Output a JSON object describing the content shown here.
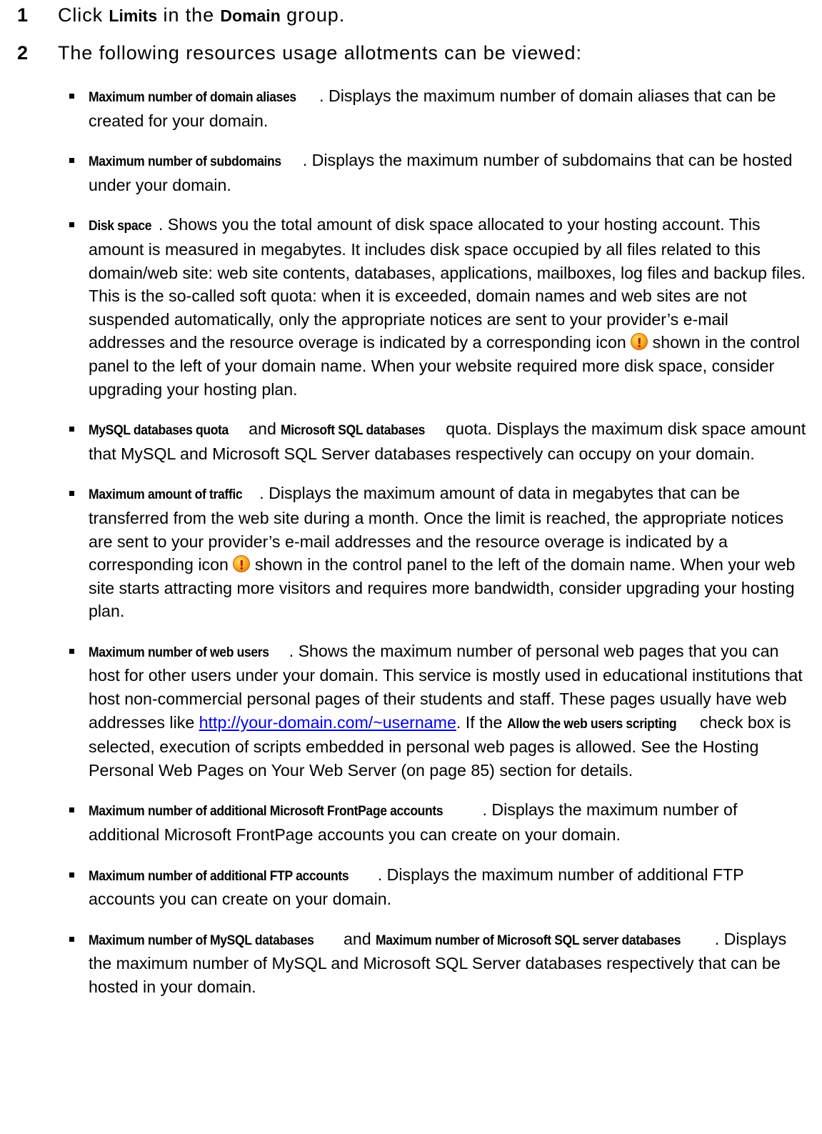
{
  "step1": {
    "number": "1",
    "pre": "Click ",
    "limits": "Limits",
    "mid": " in the ",
    "domain": "Domain",
    "post": " group."
  },
  "step2": {
    "number": "2",
    "text": "The following resources usage allotments can be viewed:"
  },
  "items": {
    "domain_aliases": {
      "term": "Maximum number of domain aliases",
      "desc": ". Displays the maximum number of domain aliases that can be created for your domain."
    },
    "subdomains": {
      "term": "Maximum number of subdomains",
      "desc": ". Displays the maximum number of subdomains that can be hosted under your domain."
    },
    "disk_space": {
      "term": "Disk space",
      "desc1": ". Shows you the total amount of disk space allocated to your hosting account. This amount is measured in megabytes. It includes disk space occupied by all files related to this domain/web site: web site contents, databases, applications, mailboxes, log files and backup files. This is the so-called soft quota: when it is exceeded, domain names and web sites are not suspended automatically, only the appropriate notices are sent to your provider’s e-mail addresses and the resource overage is indicated by a corresponding icon ",
      "desc2": " shown in the control panel to the left of your domain name. When your website required more disk space, consider upgrading your hosting plan."
    },
    "sql_quota": {
      "term1": "MySQL databases quota",
      "and": " and ",
      "term2": "Microsoft SQL databases",
      "desc": " quota. Displays the maximum disk space amount that MySQL and Microsoft SQL Server databases respectively can occupy on your domain."
    },
    "traffic": {
      "term": "Maximum amount of traffic",
      "desc1": ". Displays the maximum amount of data in megabytes that can be transferred from the web site during a month. Once the limit is reached, the appropriate notices are sent to your provider’s e-mail addresses and the resource overage is indicated by a corresponding icon ",
      "desc2": " shown in the control panel to the left of the domain name. When your web site starts attracting more visitors and requires more bandwidth, consider upgrading your hosting plan."
    },
    "web_users": {
      "term": "Maximum number of web users",
      "desc1": ". Shows the maximum number of personal web pages that you can host for other users under your domain. This service is mostly used in educational institutions that host non-commercial personal pages of their students and staff. These pages usually have web addresses like ",
      "link": "http://your-domain.com/~username",
      "desc2": ". If the ",
      "term2": "Allow the web users scripting",
      "desc3": " check box is selected, execution of scripts embedded in personal web pages is allowed. See the Hosting Personal Web Pages on Your Web Server (on page 85) section for details."
    },
    "frontpage": {
      "term": "Maximum number of additional Microsoft FrontPage accounts",
      "desc": ". Displays the maximum number of additional Microsoft FrontPage accounts you can create on your domain."
    },
    "ftp": {
      "term": "Maximum number of additional FTP accounts",
      "desc": ". Displays the maximum number of additional FTP accounts you can create on your domain."
    },
    "db_count": {
      "term1": "Maximum number of MySQL databases",
      "and": " and ",
      "term2": "Maximum number of Microsoft SQL server databases",
      "desc": ". Displays the maximum number of MySQL and Microsoft SQL Server databases respectively that can be hosted in your domain."
    }
  },
  "icons": {
    "warning": "warning-icon"
  }
}
